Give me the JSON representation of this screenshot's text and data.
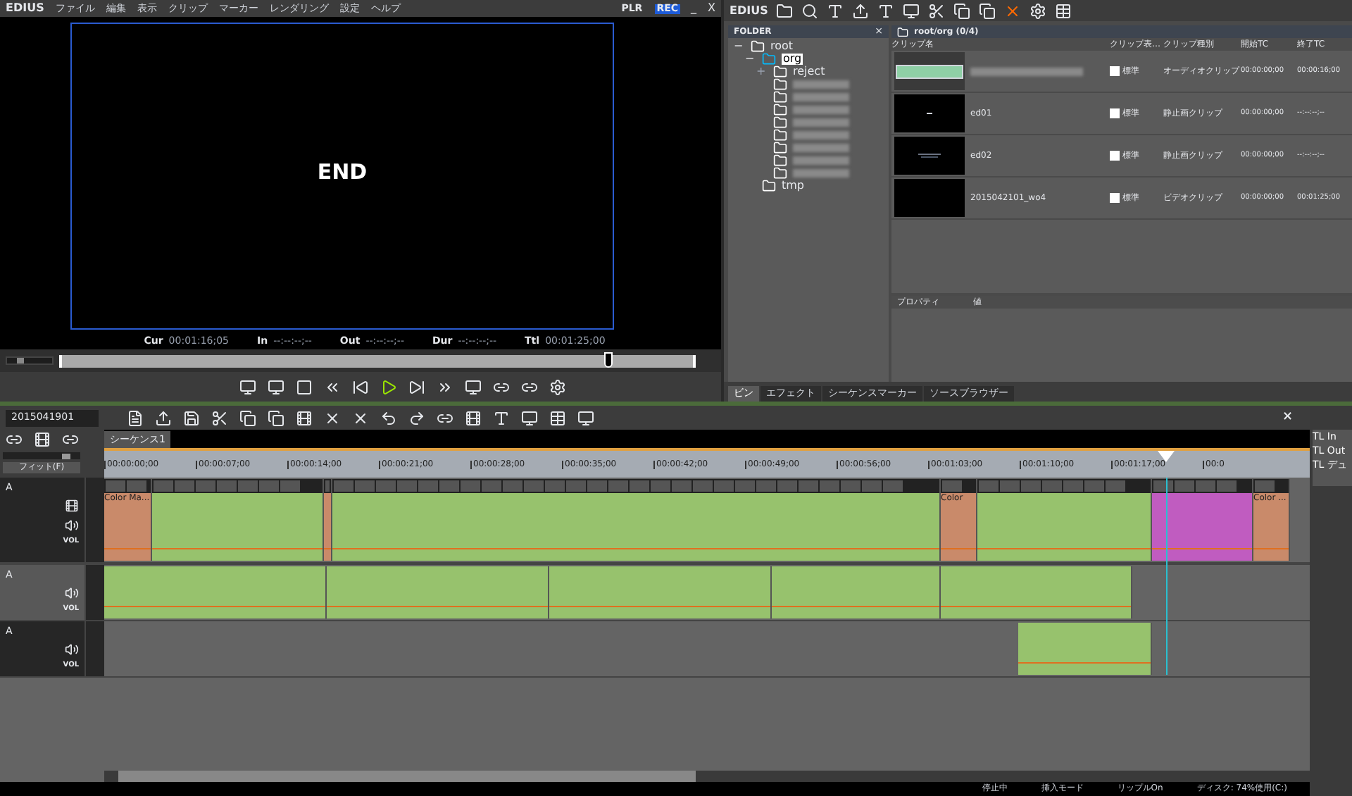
{
  "menu": {
    "app": "EDIUS",
    "items": [
      "ファイル",
      "編集",
      "表示",
      "クリップ",
      "マーカー",
      "レンダリング",
      "設定",
      "ヘルプ"
    ],
    "modes": [
      {
        "label": "PLR",
        "selected": false
      },
      {
        "label": "REC",
        "selected": true
      }
    ],
    "minimize": "_",
    "close": "X"
  },
  "player": {
    "frame_text": "END",
    "timecodes": [
      {
        "label": "Cur",
        "value": "00:01:16;05"
      },
      {
        "label": "In",
        "value": "--:--:--;--"
      },
      {
        "label": "Out",
        "value": "--:--:--;--"
      },
      {
        "label": "Dur",
        "value": "--:--:--;--"
      },
      {
        "label": "Ttl",
        "value": "00:01:25;00"
      }
    ],
    "scrubber": {
      "level": 0.86
    },
    "zoom": {
      "level": 0.25
    }
  },
  "bin": {
    "app": "EDIUS",
    "folder_title": "FOLDER",
    "folder_close": "×",
    "tree": [
      {
        "kind": "folder",
        "name": "root",
        "sign": "−",
        "expanded": true,
        "selected": false,
        "children": [
          {
            "kind": "folder",
            "name": "org",
            "sign": "−",
            "expanded": true,
            "selected": true,
            "children": [
              {
                "kind": "folder",
                "name": "reject",
                "sign": "+",
                "expanded": false,
                "selected": false
              },
              {
                "kind": "blurred",
                "selected": false
              },
              {
                "kind": "blurred",
                "selected": false
              },
              {
                "kind": "blurred",
                "selected": false
              },
              {
                "kind": "blurred",
                "selected": false
              },
              {
                "kind": "blurred",
                "selected": false
              },
              {
                "kind": "blurred",
                "selected": false
              },
              {
                "kind": "blurred",
                "selected": false
              },
              {
                "kind": "blurred",
                "selected": false
              }
            ]
          },
          {
            "kind": "folder",
            "name": "tmp",
            "selected": false
          }
        ]
      }
    ],
    "path": "root/org (0/4)",
    "columns": [
      "クリップ名",
      "クリップ表…",
      "クリップ種別",
      "開始TC",
      "終了TC"
    ],
    "clips": [
      {
        "kind": "audio",
        "checked": false,
        "display": "標準",
        "type": "オーディオクリップ",
        "start": "00:00:00;00",
        "end": "00:00:16;00"
      },
      {
        "kind": "still",
        "name": "ed01",
        "checked": false,
        "display": "標準",
        "type": "静止画クリップ",
        "start": "00:00:00;00",
        "end": "--:--:--;--"
      },
      {
        "kind": "still2",
        "name": "ed02",
        "checked": false,
        "display": "標準",
        "type": "静止画クリップ",
        "start": "00:00:00;00",
        "end": "--:--:--;--"
      },
      {
        "kind": "video",
        "name": "2015042101_wo4",
        "checked": false,
        "display": "標準",
        "type": "ビデオクリップ",
        "start": "00:00:00;00",
        "end": "00:01:25;00"
      }
    ],
    "properties": {
      "columns": [
        "プロパティ",
        "値"
      ]
    },
    "tabs": [
      {
        "label": "ビン",
        "selected": true
      },
      {
        "label": "エフェクト",
        "selected": false
      },
      {
        "label": "シーケンスマーカー",
        "selected": false
      },
      {
        "label": "ソースブラウザー",
        "selected": false
      }
    ]
  },
  "timeline": {
    "sequence_field": "2015041901",
    "sequence_tab": "シーケンス1",
    "close": "×",
    "fit": "フィット(F)",
    "zoom": {
      "level": 0.85
    },
    "ruler": [
      "00:00:00;00",
      "00:00:07;00",
      "00:00:14;00",
      "00:00:21;00",
      "00:00:28;00",
      "00:00:35;00",
      "00:00:42;00",
      "00:00:49;00",
      "00:00:56;00",
      "00:01:03;00",
      "00:01:10;00",
      "00:01:17;00",
      "00:0"
    ],
    "tracks": [
      {
        "kind": "va",
        "name": "A",
        "vol": "VOL",
        "clips": [
          {
            "kind": "color",
            "label": "Color Ma..."
          },
          {
            "kind": "video"
          },
          {
            "kind": "color"
          },
          {
            "kind": "video"
          },
          {
            "kind": "color",
            "label": "Color"
          },
          {
            "kind": "video"
          },
          {
            "kind": "title"
          },
          {
            "kind": "color",
            "label": "Color ..."
          }
        ]
      },
      {
        "kind": "a",
        "name": "A",
        "vol": "VOL",
        "clips": [
          {
            "kind": "audio"
          },
          {
            "kind": "audio"
          },
          {
            "kind": "audio"
          },
          {
            "kind": "audio"
          },
          {
            "kind": "audio"
          }
        ]
      },
      {
        "kind": "a",
        "name": "A",
        "vol": "VOL",
        "clips": [
          {
            "kind": "audio"
          }
        ]
      }
    ],
    "side_panel": [
      "TL In",
      "TL Out",
      "TL デュ"
    ],
    "status": [
      "停止中",
      "挿入モード",
      "リップルOn",
      "ディスク: 74%使用(C:)"
    ]
  }
}
